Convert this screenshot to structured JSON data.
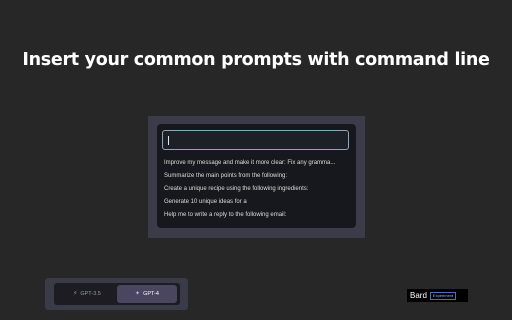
{
  "headline": "Insert your common prompts with command line",
  "command_palette": {
    "input_value": "",
    "prompts": [
      "Improve my message and make it more clear: Fix any gramma...",
      "Summarize the main points from the following:",
      "Create a unique recipe using the following ingredients:",
      "Generate 10 unique ideas for a",
      "Help me to write a reply to the following email:"
    ]
  },
  "model_switch": {
    "options": [
      {
        "label": "GPT-3.5",
        "icon": "lightning-icon",
        "selected": false
      },
      {
        "label": "GPT-4",
        "icon": "sparkle-icon",
        "selected": true
      }
    ]
  },
  "bard_badge": {
    "name": "Bard",
    "tag": "Experiment"
  },
  "colors": {
    "background": "#272727",
    "frame": "#3b3b4a",
    "palette": "#17181d",
    "input_border": "#8aa8bc",
    "selected_tab": "#4a4660"
  }
}
